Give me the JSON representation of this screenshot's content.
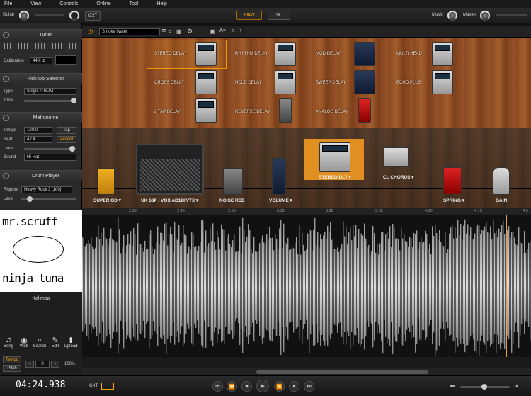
{
  "menu": [
    "File",
    "View",
    "Controls",
    "Online",
    "Tool",
    "Help"
  ],
  "top": {
    "guitar": "Guitar",
    "gxt": "GXT",
    "effect_tab": "Effect",
    "gxt_tab": "GXT",
    "music": "Music",
    "master": "Master"
  },
  "preset": {
    "name": "Smoke Water"
  },
  "tuner": {
    "title": "Tuner",
    "calibration_label": "Calibration",
    "calibration_value": "440Hz"
  },
  "pickup": {
    "title": "Pick-Up Selector",
    "type_label": "Type",
    "type_value": "Single > HUM",
    "tone_label": "Tone"
  },
  "metronome": {
    "title": "Metronome",
    "tempo_label": "Tempo",
    "tempo_value": "120.0",
    "tap": "Tap",
    "beat_label": "Beat",
    "beat_value": "4 / 4",
    "accent": "Accent",
    "level_label": "Level",
    "sound_label": "Sound",
    "sound_value": "Hi-Hat"
  },
  "drum": {
    "title": "Drum Player",
    "rhythm_label": "Rhythm",
    "rhythm_value": "Heavy Rock 3 [100]",
    "level_label": "Level"
  },
  "fx_list": {
    "c1": [
      "STEREO DELAY",
      "CROSS DELAY",
      "2 TAP DELAY"
    ],
    "c2": [
      "RHYTHM DELAY",
      "HOLD DELAY",
      "REVERSE DELAY"
    ],
    "c3": [
      "MOD DELAY",
      "SWEEP DELAY",
      "ANALOG DELAY"
    ],
    "c4": [
      "MULTI HEAD",
      "ECHO PLUS"
    ]
  },
  "chain": [
    "SUPER OD▼",
    "UK 68P / VOX AD120VTX▼",
    "NOISE RED",
    "VOLUME▼",
    "STEREO DLY▼",
    "CL CHORUS▼",
    "SPRING▼",
    "GAIN"
  ],
  "timeline": [
    "2:38",
    "2:45",
    "2:50",
    "3:15",
    "3:28",
    "3:65",
    "4:00",
    "4:15",
    "4:3"
  ],
  "album": {
    "line1": "mr.scruff",
    "line2": "ninja tuna"
  },
  "track": {
    "name": "Kalimba"
  },
  "tools": [
    "Song",
    "Web",
    "Search",
    "Edit",
    "Upload"
  ],
  "tempo_ctrl": {
    "tempo": "Tempo",
    "pitch": "Pitch",
    "value": "0",
    "percent": "100%"
  },
  "time": "04:24.938",
  "bottom_gxt": "GXT"
}
